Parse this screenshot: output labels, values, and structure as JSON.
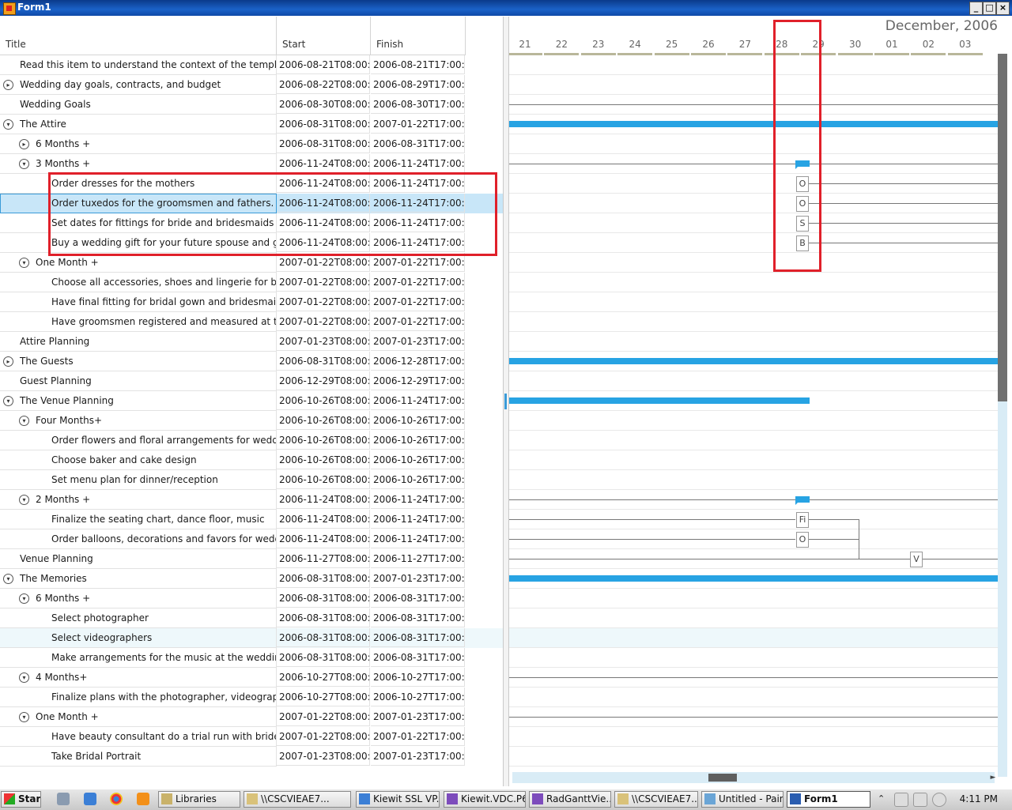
{
  "window": {
    "title": "Form1",
    "buttons": [
      "_",
      "□",
      "×"
    ]
  },
  "grid": {
    "columns": [
      "Title",
      "Start",
      "Finish"
    ],
    "rows": [
      {
        "title": "Read this item to understand the context of the template",
        "start": "2006-08-21T08:00:0",
        "finish": "2006-08-21T17:00:0",
        "level": 0,
        "expander": "none"
      },
      {
        "title": "Wedding day goals, contracts, and budget",
        "start": "2006-08-22T08:00:0",
        "finish": "2006-08-29T17:00:0",
        "level": 0,
        "expander": "collapsed"
      },
      {
        "title": "Wedding Goals",
        "start": "2006-08-30T08:00:0",
        "finish": "2006-08-30T17:00:0",
        "level": 0,
        "expander": "none"
      },
      {
        "title": "The Attire",
        "start": "2006-08-31T08:00:0",
        "finish": "2007-01-22T17:00:0",
        "level": 0,
        "expander": "expanded"
      },
      {
        "title": "6 Months +",
        "start": "2006-08-31T08:00:0",
        "finish": "2006-08-31T17:00:0",
        "level": 1,
        "expander": "collapsed"
      },
      {
        "title": "3 Months +",
        "start": "2006-11-24T08:00:0",
        "finish": "2006-11-24T17:00:0",
        "level": 1,
        "expander": "expanded"
      },
      {
        "title": "Order dresses for the mothers",
        "start": "2006-11-24T08:00:0",
        "finish": "2006-11-24T17:00:0",
        "level": 2,
        "expander": "none"
      },
      {
        "title": "Order tuxedos for the groomsmen and fathers.",
        "start": "2006-11-24T08:00:0",
        "finish": "2006-11-24T17:00:0",
        "level": 2,
        "expander": "none",
        "selected": true
      },
      {
        "title": "Set dates for fittings for bride and bridesmaids",
        "start": "2006-11-24T08:00:0",
        "finish": "2006-11-24T17:00:0",
        "level": 2,
        "expander": "none"
      },
      {
        "title": "Buy a wedding gift for your future spouse and gifts",
        "start": "2006-11-24T08:00:0",
        "finish": "2006-11-24T17:00:0",
        "level": 2,
        "expander": "none"
      },
      {
        "title": "One Month +",
        "start": "2007-01-22T08:00:0",
        "finish": "2007-01-22T17:00:0",
        "level": 1,
        "expander": "expanded"
      },
      {
        "title": "Choose all accessories, shoes and lingerie for bridal",
        "start": "2007-01-22T08:00:0",
        "finish": "2007-01-22T17:00:0",
        "level": 2,
        "expander": "none"
      },
      {
        "title": "Have final fitting for bridal gown and bridesmaids'",
        "start": "2007-01-22T08:00:0",
        "finish": "2007-01-22T17:00:0",
        "level": 2,
        "expander": "none"
      },
      {
        "title": "Have groomsmen registered and measured at the f",
        "start": "2007-01-22T08:00:0",
        "finish": "2007-01-22T17:00:0",
        "level": 2,
        "expander": "none"
      },
      {
        "title": "Attire Planning",
        "start": "2007-01-23T08:00:0",
        "finish": "2007-01-23T17:00:0",
        "level": 0,
        "expander": "none"
      },
      {
        "title": "The Guests",
        "start": "2006-08-31T08:00:0",
        "finish": "2006-12-28T17:00:0",
        "level": 0,
        "expander": "collapsed"
      },
      {
        "title": "Guest Planning",
        "start": "2006-12-29T08:00:0",
        "finish": "2006-12-29T17:00:0",
        "level": 0,
        "expander": "none"
      },
      {
        "title": "The Venue Planning",
        "start": "2006-10-26T08:00:0",
        "finish": "2006-11-24T17:00:0",
        "level": 0,
        "expander": "expanded"
      },
      {
        "title": "Four Months+",
        "start": "2006-10-26T08:00:0",
        "finish": "2006-10-26T17:00:0",
        "level": 1,
        "expander": "expanded"
      },
      {
        "title": "Order flowers and floral arrangements for wedding",
        "start": "2006-10-26T08:00:0",
        "finish": "2006-10-26T17:00:0",
        "level": 2,
        "expander": "none"
      },
      {
        "title": "Choose baker and cake design",
        "start": "2006-10-26T08:00:0",
        "finish": "2006-10-26T17:00:0",
        "level": 2,
        "expander": "none"
      },
      {
        "title": "Set menu plan for dinner/reception",
        "start": "2006-10-26T08:00:0",
        "finish": "2006-10-26T17:00:0",
        "level": 2,
        "expander": "none"
      },
      {
        "title": "2 Months +",
        "start": "2006-11-24T08:00:0",
        "finish": "2006-11-24T17:00:0",
        "level": 1,
        "expander": "expanded"
      },
      {
        "title": "Finalize the seating chart, dance floor, music",
        "start": "2006-11-24T08:00:0",
        "finish": "2006-11-24T17:00:0",
        "level": 2,
        "expander": "none"
      },
      {
        "title": "Order balloons, decorations and favors for wedding",
        "start": "2006-11-24T08:00:0",
        "finish": "2006-11-24T17:00:0",
        "level": 2,
        "expander": "none"
      },
      {
        "title": "Venue Planning",
        "start": "2006-11-27T08:00:0",
        "finish": "2006-11-27T17:00:0",
        "level": 0,
        "expander": "none"
      },
      {
        "title": "The Memories",
        "start": "2006-08-31T08:00:0",
        "finish": "2007-01-23T17:00:0",
        "level": 0,
        "expander": "expanded"
      },
      {
        "title": "6 Months +",
        "start": "2006-08-31T08:00:0",
        "finish": "2006-08-31T17:00:0",
        "level": 1,
        "expander": "expanded"
      },
      {
        "title": "Select photographer",
        "start": "2006-08-31T08:00:0",
        "finish": "2006-08-31T17:00:0",
        "level": 2,
        "expander": "none"
      },
      {
        "title": "Select videographers",
        "start": "2006-08-31T08:00:0",
        "finish": "2006-08-31T17:00:0",
        "level": 2,
        "expander": "none",
        "hover": true
      },
      {
        "title": "Make arrangements for the music at the wedding a",
        "start": "2006-08-31T08:00:0",
        "finish": "2006-08-31T17:00:0",
        "level": 2,
        "expander": "none"
      },
      {
        "title": "4 Months+",
        "start": "2006-10-27T08:00:0",
        "finish": "2006-10-27T17:00:0",
        "level": 1,
        "expander": "expanded"
      },
      {
        "title": "Finalize plans with the photographer, videographer,",
        "start": "2006-10-27T08:00:0",
        "finish": "2006-10-27T17:00:0",
        "level": 2,
        "expander": "none"
      },
      {
        "title": "One Month +",
        "start": "2007-01-22T08:00:0",
        "finish": "2007-01-23T17:00:0",
        "level": 1,
        "expander": "expanded"
      },
      {
        "title": "Have beauty consultant do a trial run with bride's h",
        "start": "2007-01-22T08:00:0",
        "finish": "2007-01-22T17:00:0",
        "level": 2,
        "expander": "none"
      },
      {
        "title": "Take Bridal Portrait",
        "start": "2007-01-23T08:00:0",
        "finish": "2007-01-23T17:00:0",
        "level": 2,
        "expander": "none"
      }
    ]
  },
  "timeline": {
    "month_label": "December, 2006",
    "days": [
      "21",
      "22",
      "23",
      "24",
      "25",
      "26",
      "27",
      "28",
      "29",
      "30",
      "01",
      "02",
      "03"
    ],
    "bar_color": "#27a3e3",
    "task_letters": [
      "O",
      "O",
      "S",
      "B",
      "Fi",
      "O",
      "V"
    ]
  },
  "taskbar": {
    "start_label": "Start",
    "items": [
      {
        "label": "Libraries",
        "active": false
      },
      {
        "label": "\\\\CSCVIEAE7...",
        "active": false
      },
      {
        "label": "Kiewit SSL VP...",
        "active": false
      },
      {
        "label": "Kiewit.VDC.P6...",
        "active": false
      },
      {
        "label": "RadGanttVie...",
        "active": false
      },
      {
        "label": "\\\\CSCVIEAE7...",
        "active": false
      },
      {
        "label": "Untitled - Paint",
        "active": false
      },
      {
        "label": "Form1",
        "active": true
      }
    ],
    "clock": "4:11 PM"
  }
}
